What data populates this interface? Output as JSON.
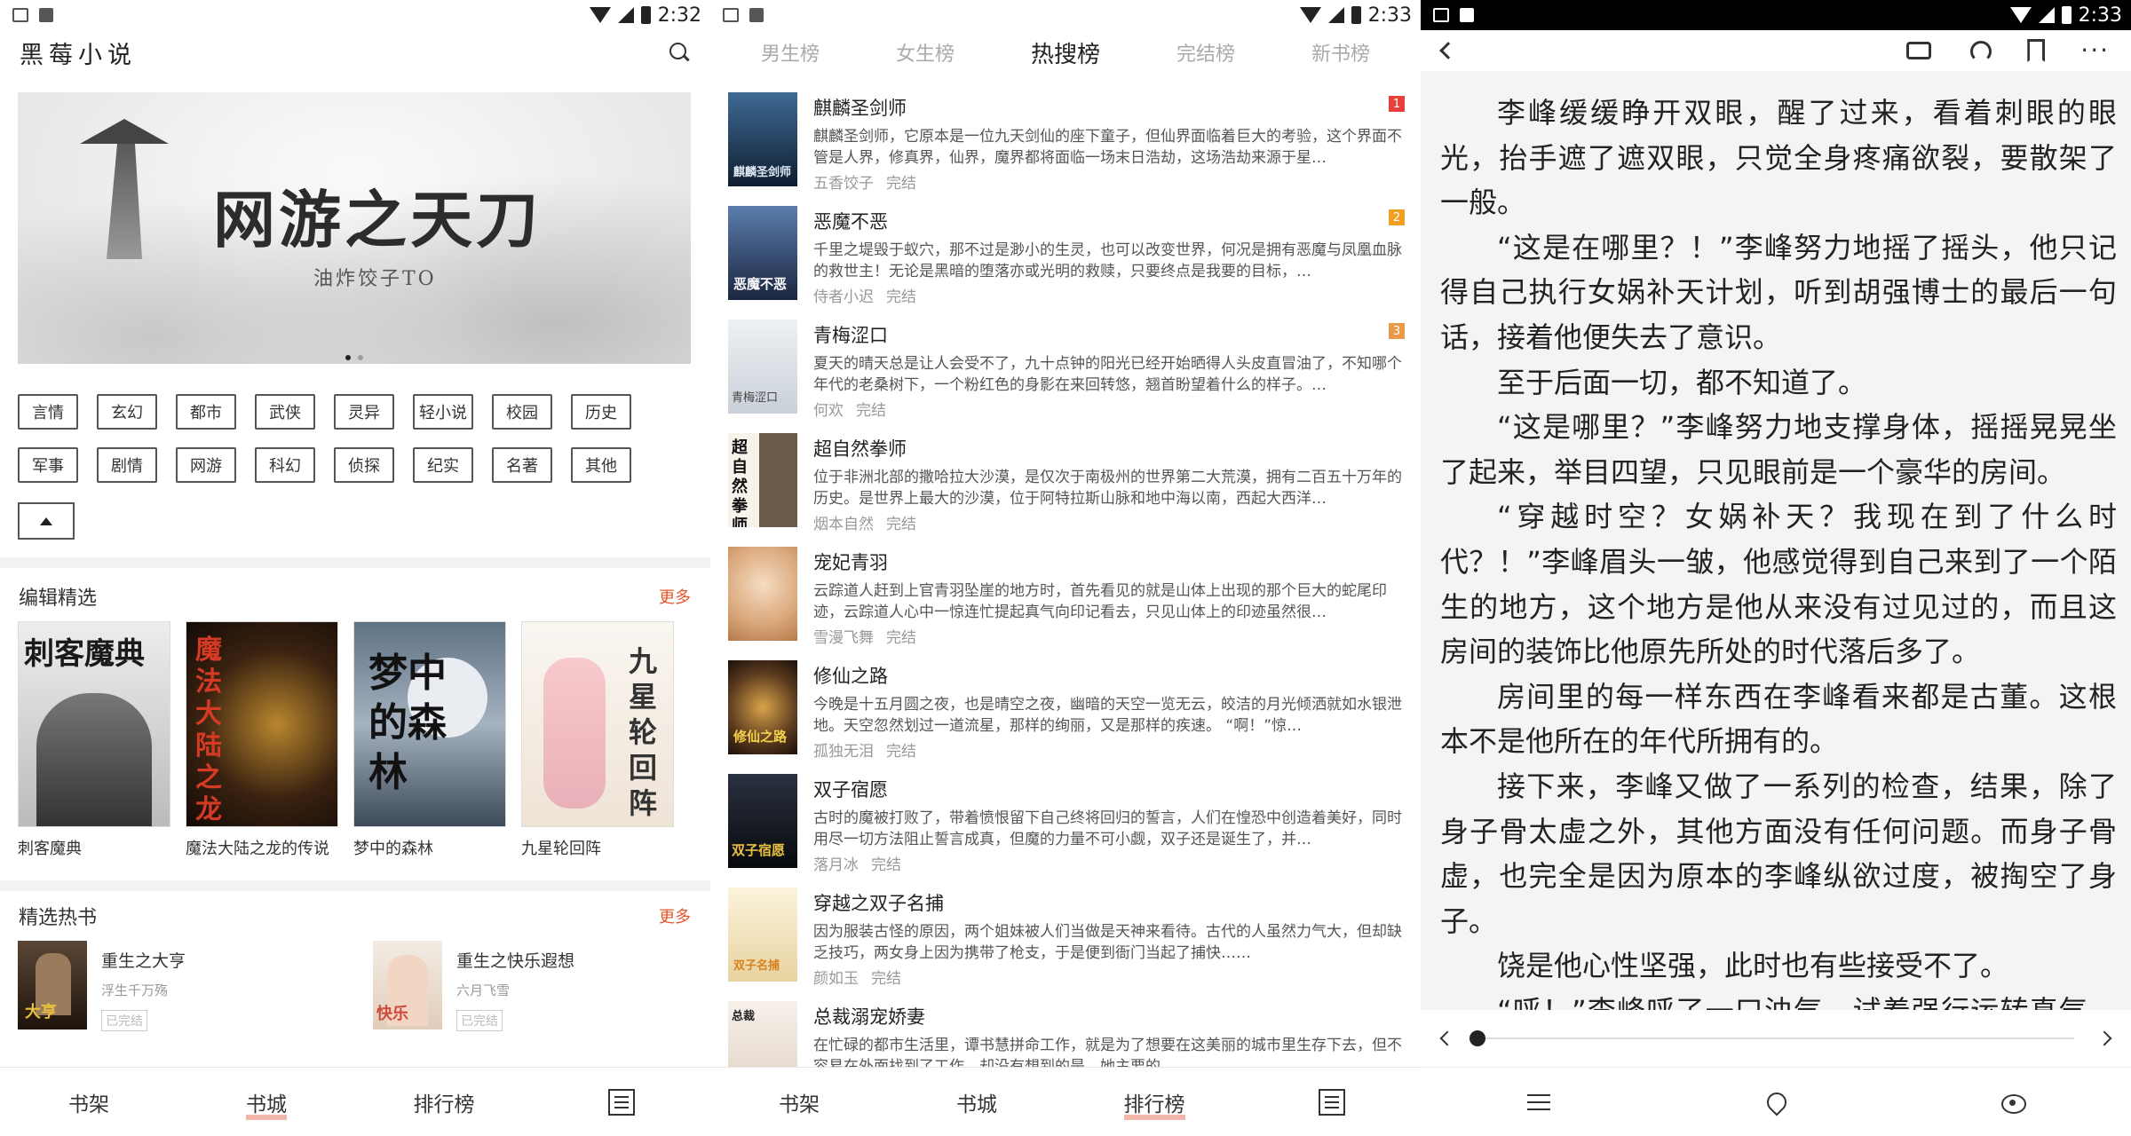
{
  "status_bars": [
    {
      "time": "2:32"
    },
    {
      "time": "2:33"
    },
    {
      "time": "2:33"
    }
  ],
  "store": {
    "app_title": "黑莓小说",
    "banner": {
      "title": "网游之天刀",
      "author": "油炸饺子TO"
    },
    "genres": [
      "言情",
      "玄幻",
      "都市",
      "武侠",
      "灵异",
      "轻小说",
      "校园",
      "历史",
      "军事",
      "剧情",
      "网游",
      "科幻",
      "侦探",
      "纪实",
      "名著",
      "其他"
    ],
    "editor_picks": {
      "title": "编辑精选",
      "more": "更多",
      "books": [
        {
          "name": "刺客魔典",
          "cover_text": "刺客魔典",
          "cover_bg": "#e8e8e8",
          "cover_fg": "#1a1a1a"
        },
        {
          "name": "魔法大陆之龙的传说",
          "cover_text": "魔法大陆之龙的传说",
          "cover_bg": "#2a1a10",
          "cover_fg": "#c0392b"
        },
        {
          "name": "梦中的森林",
          "cover_text": "梦中的森林",
          "cover_bg": "#6b7d8f",
          "cover_fg": "#1b1b1b"
        },
        {
          "name": "九星轮回阵",
          "cover_text": "九星轮回阵",
          "cover_bg": "#f3ece6",
          "cover_fg": "#3a3a3a"
        }
      ]
    },
    "hot_picks": {
      "title": "精选热书",
      "more": "更多",
      "books": [
        {
          "name": "重生之大亨",
          "author": "浮生千万殇",
          "status": "已完结",
          "cover_bg": "#3a2c20"
        },
        {
          "name": "重生之快乐遐想",
          "author": "六月飞雪",
          "status": "已完结",
          "cover_bg": "#e9dcd0"
        }
      ]
    },
    "nav": [
      "书架",
      "书城",
      "排行榜"
    ],
    "active_nav": 1
  },
  "ranking": {
    "tabs": [
      "男生榜",
      "女生榜",
      "热搜榜",
      "完结榜",
      "新书榜"
    ],
    "active_tab": 2,
    "items": [
      {
        "title": "麒麟圣剑师",
        "desc": "麒麟圣剑师，它原本是一位九天剑仙的座下童子，但仙界面临着巨大的考验，这个界面不管是人界，修真界，仙界，魔界都将面临一场末日浩劫，这场浩劫来源于星…",
        "author": "五香饺子",
        "status": "完结",
        "badge": "1",
        "badge_color": "#e8403a",
        "cover_bg": "#1e3550"
      },
      {
        "title": "恶魔不恶",
        "desc": "千里之堤毁于蚁穴，那不过是渺小的生灵，也可以改变世界，何况是拥有恶魔与凤凰血脉的救世主！无论是黑暗的堕落亦或光明的救赎，只要终点是我要的目标，…",
        "author": "侍者小迟",
        "status": "完结",
        "badge": "2",
        "badge_color": "#f0a020",
        "cover_bg": "#2a3a55"
      },
      {
        "title": "青梅涩口",
        "desc": "夏天的晴天总是让人会受不了，九十点钟的阳光已经开始晒得人头皮直冒油了，不知哪个年代的老桑树下，一个粉红色的身影在来回转悠，翘首盼望着什么的样子。…",
        "author": "何欢",
        "status": "完结",
        "badge": "3",
        "badge_color": "#e89a4a",
        "cover_bg": "#d9dde2"
      },
      {
        "title": "超自然拳师",
        "desc": "位于非洲北部的撒哈拉大沙漠，是仅次于南极州的世界第二大荒漠，拥有二百五十万年的历史。是世界上最大的沙漠，位于阿特拉斯山脉和地中海以南，西起大西洋…",
        "author": "烟本自然",
        "status": "完结",
        "badge": "",
        "badge_color": "",
        "cover_bg": "#efe8df"
      },
      {
        "title": "宠妃青羽",
        "desc": "云踪道人赶到上官青羽坠崖的地方时，首先看见的就是山体上出现的那个巨大的蛇尾印迹，云踪道人心中一惊连忙提起真气向印记看去，只见山体上的印迹虽然很…",
        "author": "雪漫飞舞",
        "status": "完结",
        "badge": "",
        "badge_color": "",
        "cover_bg": "#e7c9a8"
      },
      {
        "title": "修仙之路",
        "desc": "今晚是十五月圆之夜，也是晴空之夜，幽暗的天空一览无云，皎洁的月光倾洒就如水银泄地。天空忽然划过一道流星，那样的绚丽，又是那样的疾速。 “啊！”惊…",
        "author": "孤独无泪",
        "status": "完结",
        "badge": "",
        "badge_color": "",
        "cover_bg": "#3b2a1e"
      },
      {
        "title": "双子宿愿",
        "desc": "古时的魔被打败了，带着愤恨留下自己终将回归的誓言，人们在惶恐中创造着美好，同时用尽一切方法阻止誓言成真，但魔的力量不可小觑，双子还是诞生了，并…",
        "author": "落月冰",
        "status": "完结",
        "badge": "",
        "badge_color": "",
        "cover_bg": "#151a22"
      },
      {
        "title": "穿越之双子名捕",
        "desc": "因为服装古怪的原因，两个姐妹被人们当做是天神来看待。古代的人虽然力气大，但却缺乏技巧，两女身上因为携带了枪支，于是便到衙门当起了捕快……",
        "author": "颜如玉",
        "status": "完结",
        "badge": "",
        "badge_color": "",
        "cover_bg": "#f1e6c8"
      },
      {
        "title": "总裁溺宠娇妻",
        "desc": "在忙碌的都市生活里，谭书慧拼命工作，就是为了想要在这美丽的城市里生存下去，但不容易在外面找到了工作，却没有想到的是，她主要的…",
        "author": "",
        "status": "",
        "badge": "",
        "badge_color": "",
        "cover_bg": "#ece4dc"
      }
    ],
    "nav": [
      "书架",
      "书城",
      "排行榜"
    ],
    "active_nav": 2
  },
  "reader": {
    "paragraphs": [
      "李峰缓缓睁开双眼，醒了过来，看着刺眼的眼光，抬手遮了遮双眼，只觉全身疼痛欲裂，要散架了一般。",
      "“这是在哪里？！”李峰努力地摇了摇头，他只记得自己执行女娲补天计划，听到胡强博士的最后一句话，接着他便失去了意识。",
      "至于后面一切，都不知道了。",
      "“这是哪里？”李峰努力地支撑身体，摇摇晃晃坐了起来，举目四望，只见眼前是一个豪华的房间。",
      "“穿越时空？女娲补天？我现在到了什么时代？！”李峰眉头一皱，他感觉得到自己来到了一个陌生的地方，这个地方是他从来没有过见过的，而且这房间的装饰比他原先所处的时代落后多了。",
      "房间里的每一样东西在李峰看来都是古董。这根本不是他所在的年代所拥有的。",
      "接下来，李峰又做了一系列的检查，结果，除了身子骨太虚之外，其他方面没有任何问题。而身子骨虚，也完全是因为原本的李峰纵欲过度，被掏空了身子。",
      "饶是他心性坚强，此时也有些接受不了。",
      "“呼！”李峰呼了一口浊气，试着强行运转真气，但是一运转真气，一股钻心之痛传来，脸色惨白，接着眼前一黑，倒了下去。"
    ],
    "progress": 0.0
  }
}
